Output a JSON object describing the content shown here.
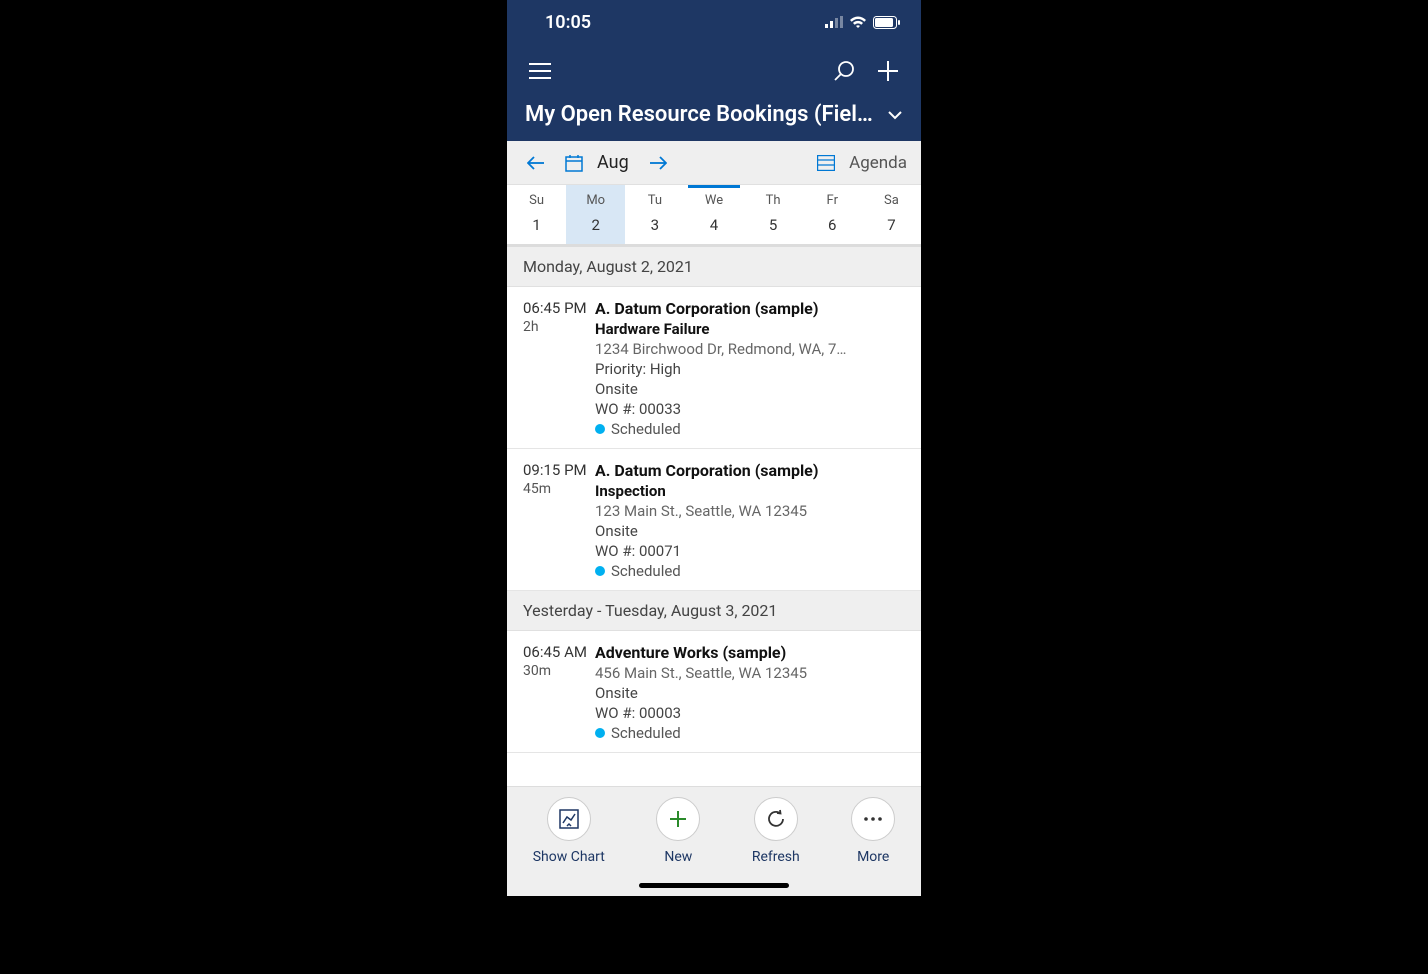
{
  "statusbar": {
    "time": "10:05"
  },
  "header": {
    "title": "My Open Resource Bookings (Fiel…"
  },
  "calnav": {
    "month": "Aug",
    "agenda_label": "Agenda"
  },
  "week": {
    "days": [
      {
        "dow": "Su",
        "num": "1"
      },
      {
        "dow": "Mo",
        "num": "2"
      },
      {
        "dow": "Tu",
        "num": "3"
      },
      {
        "dow": "We",
        "num": "4"
      },
      {
        "dow": "Th",
        "num": "5"
      },
      {
        "dow": "Fr",
        "num": "6"
      },
      {
        "dow": "Sa",
        "num": "7"
      }
    ],
    "selected_index": 1,
    "today_index": 3
  },
  "sections": [
    {
      "heading": "Monday, August 2, 2021",
      "bookings": [
        {
          "start": "06:45 PM",
          "duration": "2h",
          "title": "A. Datum Corporation (sample)",
          "subtitle": "Hardware Failure",
          "address": "1234 Birchwood Dr, Redmond, WA, 7…",
          "priority": "Priority: High",
          "mode": "Onsite",
          "wo": "WO #: 00033",
          "status": "Scheduled",
          "status_color": "#00b0f0"
        },
        {
          "start": "09:15 PM",
          "duration": "45m",
          "title": "A. Datum Corporation (sample)",
          "subtitle": "Inspection",
          "address": "123 Main St., Seattle, WA 12345",
          "priority": "",
          "mode": "Onsite",
          "wo": "WO #: 00071",
          "status": "Scheduled",
          "status_color": "#00b0f0"
        }
      ]
    },
    {
      "heading": "Yesterday - Tuesday, August 3, 2021",
      "bookings": [
        {
          "start": "06:45 AM",
          "duration": "30m",
          "title": "Adventure Works (sample)",
          "subtitle": "",
          "address": "456 Main St., Seattle, WA 12345",
          "priority": "",
          "mode": "Onsite",
          "wo": "WO #: 00003",
          "status": "Scheduled",
          "status_color": "#00b0f0"
        }
      ]
    }
  ],
  "bottombar": {
    "actions": [
      {
        "label": "Show Chart",
        "icon": "chart"
      },
      {
        "label": "New",
        "icon": "plus"
      },
      {
        "label": "Refresh",
        "icon": "refresh"
      },
      {
        "label": "More",
        "icon": "dots"
      }
    ]
  }
}
